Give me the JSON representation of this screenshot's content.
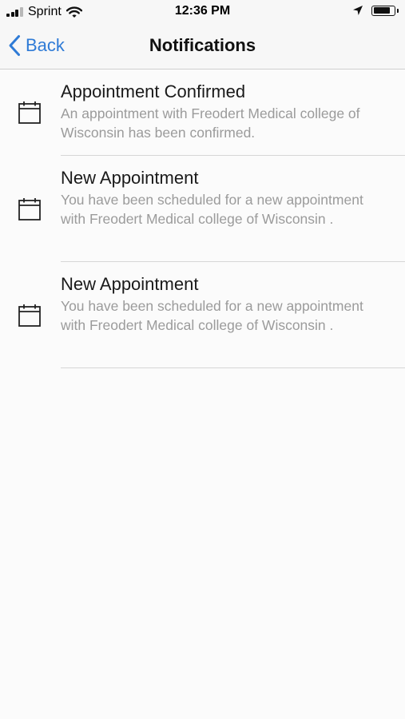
{
  "status_bar": {
    "carrier": "Sprint",
    "time": "12:36 PM",
    "signal_bars_filled": 3,
    "signal_bars_total": 4,
    "battery_level": 0.85,
    "icons": [
      "signal-icon",
      "wifi-icon",
      "location-arrow-icon",
      "battery-icon"
    ]
  },
  "nav": {
    "back_label": "Back",
    "title": "Notifications",
    "accent_color": "#2f7bd6"
  },
  "notifications": [
    {
      "icon": "calendar-icon",
      "title": "Appointment Confirmed",
      "body": "An appointment with Freodert Medical college of Wisconsin has been confirmed."
    },
    {
      "icon": "calendar-icon",
      "title": "New Appointment",
      "body": "You have been scheduled for a new appointment with Freodert Medical college of Wisconsin ."
    },
    {
      "icon": "calendar-icon",
      "title": "New Appointment",
      "body": "You have been scheduled for a new appointment with Freodert Medical college of Wisconsin ."
    }
  ]
}
